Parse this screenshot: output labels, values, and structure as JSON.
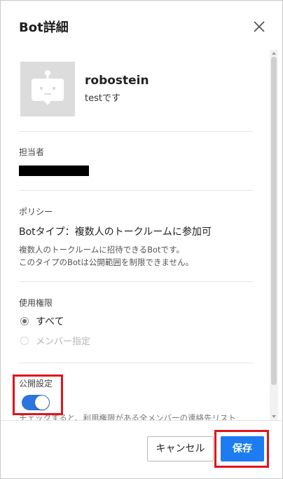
{
  "dialog": {
    "title": "Bot詳細",
    "close_icon": "close-icon"
  },
  "bot": {
    "name": "robostein",
    "description": "testです",
    "avatar_icon": "robot-icon"
  },
  "owner": {
    "label": "担当者"
  },
  "policy": {
    "label": "ポリシー",
    "type": "Botタイプ：複数人のトークルームに参加可",
    "note_line1": "複数人のトークルームに招待できるBotです。",
    "note_line2": "このタイプのBotは公開範囲を制限できません。"
  },
  "permission": {
    "label": "使用権限",
    "options": [
      {
        "label": "すべて",
        "selected": true
      },
      {
        "label": "メンバー指定",
        "selected": false,
        "disabled": true
      }
    ]
  },
  "publish": {
    "label": "公開設定",
    "enabled": true,
    "note": "チェックすると、利用権限がある全メンバーの連絡先リスト"
  },
  "footer": {
    "cancel_label": "キャンセル",
    "save_label": "保存"
  },
  "colors": {
    "accent": "#1d7cf2",
    "highlight": "#e0141c",
    "toggle": "#2c74e0"
  }
}
